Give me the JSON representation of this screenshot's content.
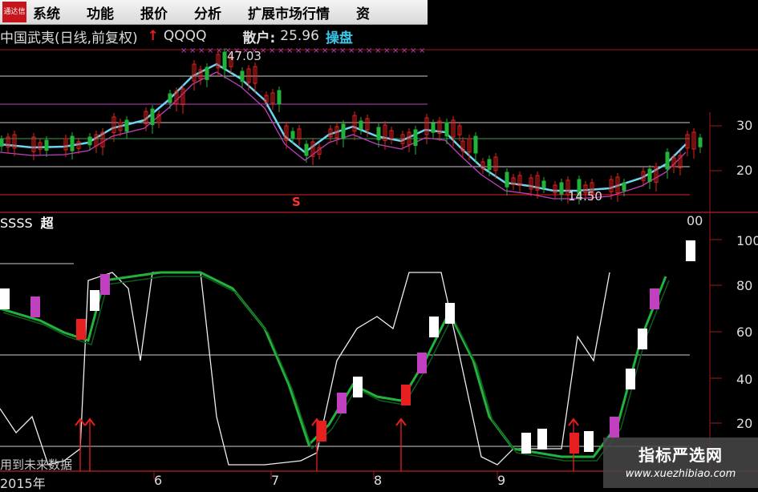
{
  "menu": {
    "logo_text": "通达信",
    "items": [
      "系统",
      "功能",
      "报价",
      "分析",
      "扩展市场行情",
      "资"
    ]
  },
  "info": {
    "stock_name": "中国武夷(日线,前复权)",
    "signal_text": "QQQQ",
    "retail_label": "散户:",
    "retail_value": "25.96",
    "operate_label": "操盘"
  },
  "upper_chart": {
    "high_label": "47.03",
    "low_label": "14.50",
    "s_marker": "S",
    "y_ticks": [
      "30",
      "20"
    ]
  },
  "lower_chart": {
    "title_left": "SSSS",
    "title_mid": "超",
    "top_right": "00",
    "y_ticks": [
      "100",
      "80",
      "60",
      "40",
      "20"
    ]
  },
  "footnote": "用到未来数据",
  "dates": [
    "2015年",
    "6",
    "7",
    "8",
    "9"
  ],
  "watermark": {
    "title": "指标严选网",
    "url": "www.xuezhibiao.com"
  },
  "colors": {
    "background": "#000000",
    "up": "#e62020",
    "down": "#22b33a",
    "cyan_line": "#6fd4f0",
    "magenta_line": "#c040c0",
    "white_line": "#ffffff",
    "grid_red": "#9b1c1c"
  }
}
